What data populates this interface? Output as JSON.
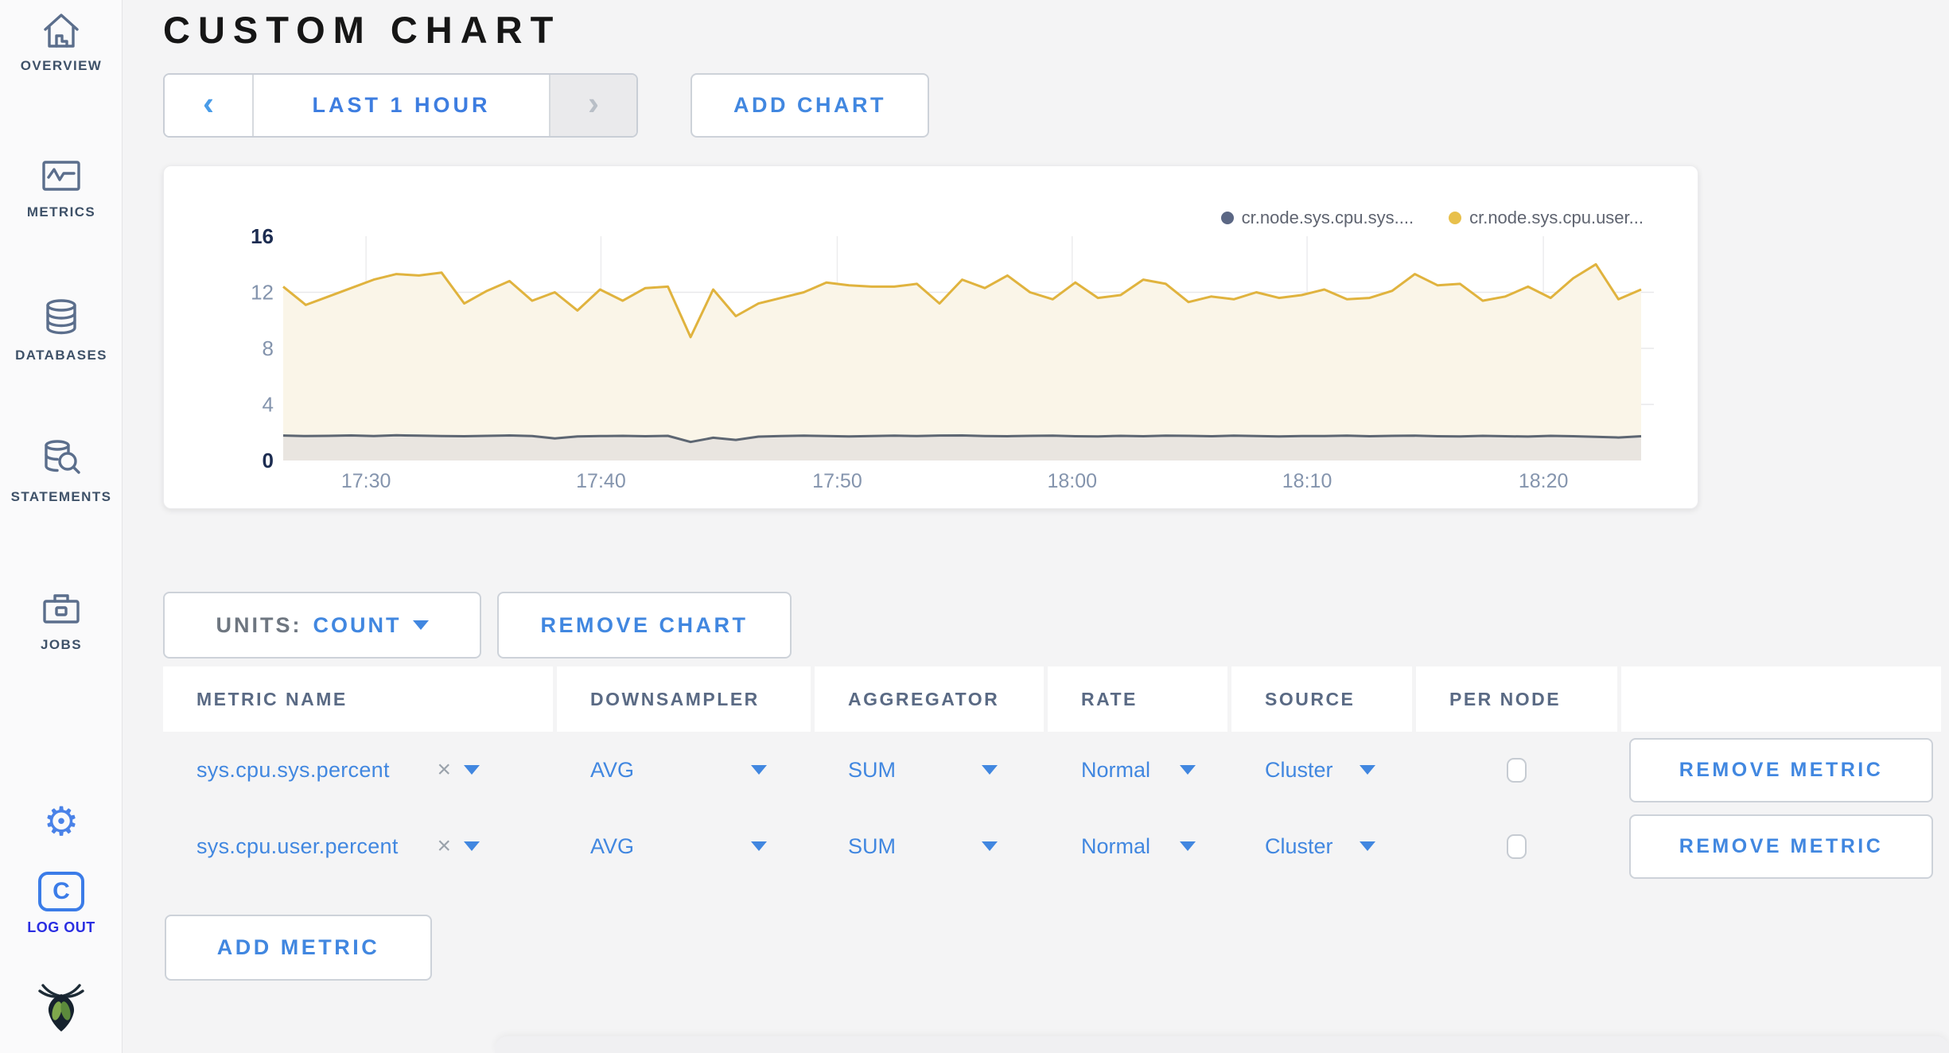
{
  "sidebar": {
    "items": [
      {
        "label": "OVERVIEW",
        "icon": "home-icon"
      },
      {
        "label": "METRICS",
        "icon": "metrics-graph-icon"
      },
      {
        "label": "DATABASES",
        "icon": "database-icon"
      },
      {
        "label": "STATEMENTS",
        "icon": "database-search-icon"
      },
      {
        "label": "JOBS",
        "icon": "briefcase-icon"
      }
    ],
    "settings_glyph": "⚙",
    "logo_letter": "C",
    "logout_label": "LOG OUT"
  },
  "header": {
    "title": "CUSTOM CHART"
  },
  "toolbar": {
    "prev_arrow": "‹",
    "time_range_label": "LAST 1 HOUR",
    "next_arrow": "›",
    "add_chart_label": "ADD CHART"
  },
  "chart_controls": {
    "units_label": "UNITS:",
    "units_value": "COUNT",
    "remove_chart_label": "REMOVE CHART"
  },
  "chart_data": {
    "type": "area",
    "title": "",
    "xlabel": "",
    "ylabel": "",
    "ylim": [
      0,
      16
    ],
    "y_ticks": [
      0,
      4,
      8,
      12,
      16
    ],
    "grid_y": [
      4,
      8,
      12
    ],
    "grid": true,
    "legend_position": "top-right",
    "x_ticks": [
      {
        "label": "17:30",
        "frac": 0.061
      },
      {
        "label": "17:40",
        "frac": 0.234
      },
      {
        "label": "17:50",
        "frac": 0.408
      },
      {
        "label": "18:00",
        "frac": 0.581
      },
      {
        "label": "18:10",
        "frac": 0.754
      },
      {
        "label": "18:20",
        "frac": 0.928
      }
    ],
    "series": [
      {
        "name": "cr.node.sys.cpu.sys....",
        "dot_color": "#5b6784",
        "line_color": "#5d6672",
        "fill_color": "#e9e5e0",
        "values": [
          1.78,
          1.74,
          1.76,
          1.79,
          1.75,
          1.8,
          1.77,
          1.74,
          1.73,
          1.76,
          1.79,
          1.74,
          1.58,
          1.72,
          1.74,
          1.76,
          1.73,
          1.76,
          1.32,
          1.62,
          1.47,
          1.7,
          1.75,
          1.77,
          1.74,
          1.72,
          1.75,
          1.77,
          1.74,
          1.78,
          1.79,
          1.75,
          1.73,
          1.76,
          1.77,
          1.73,
          1.72,
          1.76,
          1.73,
          1.77,
          1.76,
          1.73,
          1.77,
          1.74,
          1.72,
          1.75,
          1.74,
          1.77,
          1.73,
          1.76,
          1.77,
          1.73,
          1.72,
          1.76,
          1.73,
          1.71,
          1.76,
          1.73,
          1.69,
          1.64,
          1.73
        ]
      },
      {
        "name": "cr.node.sys.cpu.user...",
        "dot_color": "#e8c04c",
        "line_color": "#e0b33e",
        "fill_color": "#faf5e8",
        "values": [
          12.4,
          11.1,
          11.7,
          12.3,
          12.9,
          13.3,
          13.2,
          13.4,
          11.2,
          12.1,
          12.8,
          11.4,
          12.0,
          10.7,
          12.2,
          11.4,
          12.3,
          12.4,
          8.8,
          12.2,
          10.3,
          11.2,
          11.6,
          12.0,
          12.7,
          12.5,
          12.4,
          12.4,
          12.6,
          11.2,
          12.9,
          12.3,
          13.2,
          12.0,
          11.5,
          12.7,
          11.6,
          11.8,
          12.9,
          12.6,
          11.3,
          11.7,
          11.5,
          12.0,
          11.6,
          11.8,
          12.2,
          11.5,
          11.6,
          12.1,
          13.3,
          12.5,
          12.6,
          11.4,
          11.7,
          12.4,
          11.6,
          13.0,
          14.0,
          11.5,
          12.2
        ]
      }
    ]
  },
  "table": {
    "headers": [
      "METRIC NAME",
      "DOWNSAMPLER",
      "AGGREGATOR",
      "RATE",
      "SOURCE",
      "PER NODE",
      ""
    ],
    "rows": [
      {
        "metric": "sys.cpu.sys.percent",
        "clear": "×",
        "downsampler": "AVG",
        "aggregator": "SUM",
        "rate": "Normal",
        "source": "Cluster",
        "per_node_checked": false,
        "action": "REMOVE METRIC"
      },
      {
        "metric": "sys.cpu.user.percent",
        "clear": "×",
        "downsampler": "AVG",
        "aggregator": "SUM",
        "rate": "Normal",
        "source": "Cluster",
        "per_node_checked": false,
        "action": "REMOVE METRIC"
      }
    ],
    "add_metric_label": "ADD METRIC"
  },
  "colors": {
    "accent_blue": "#4187e0",
    "logout_blue": "#2a2ee2",
    "sidebar_slate": "#5b6e8c",
    "axis_strong": "#1c2c51",
    "axis_light": "#8494ad",
    "user_line": "#e0b33e",
    "sys_line": "#5d6672"
  }
}
